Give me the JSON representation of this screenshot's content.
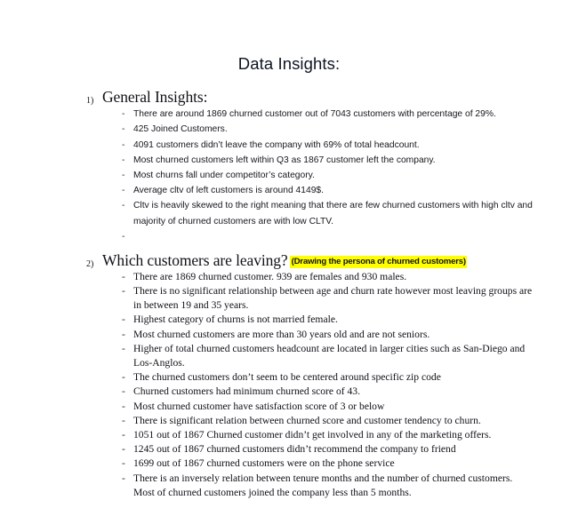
{
  "document": {
    "title": "Data Insights:",
    "bullet_marker": "-",
    "highlight_color": "#FFFF00",
    "sections": [
      {
        "number": "1)",
        "heading": "General Insights:",
        "note": "",
        "bullets": [
          "There are around 1869 churned customer out of 7043 customers with percentage of 29%.",
          "425 Joined Customers.",
          "4091 customers didn’t leave the company with 69% of total headcount.",
          "Most churned customers left within Q3 as 1867 customer left the company.",
          "Most churns fall under competitor’s category.",
          "Average cltv of left customers is around 4149$.",
          "Cltv is heavily skewed to the right meaning that there are few churned customers with high cltv and majority of churned customers are with low CLTV.",
          ""
        ]
      },
      {
        "number": "2)",
        "heading": "Which customers are leaving?",
        "note": "(Drawing the persona of churned customers)",
        "bullets": [
          "There are 1869 churned customer. 939 are females and 930 males.",
          "There is no significant relationship between age and churn rate however most leaving groups are in between 19 and 35 years.",
          "Highest category of churns is not married female.",
          "Most churned customers are more than 30 years old and are not seniors.",
          "Higher of total churned customers headcount are located in larger cities such as San-Diego and Los-Anglos.",
          "The churned customers don’t seem to be centered around specific zip code",
          "Churned customers had minimum churned score of 43.",
          "Most churned customer have satisfaction score of 3 or below",
          "There is significant relation between churned score and customer tendency to churn.",
          "1051 out of 1867 Churned customer didn’t get involved in any of the marketing offers.",
          "1245 out of 1867 churned customers didn’t recommend the company to friend",
          "1699 out of 1867 churned customers were on the phone service",
          "There is an inversely relation between tenure months and the number of churned customers. Most of churned customers joined the company less than 5 months."
        ]
      }
    ]
  }
}
